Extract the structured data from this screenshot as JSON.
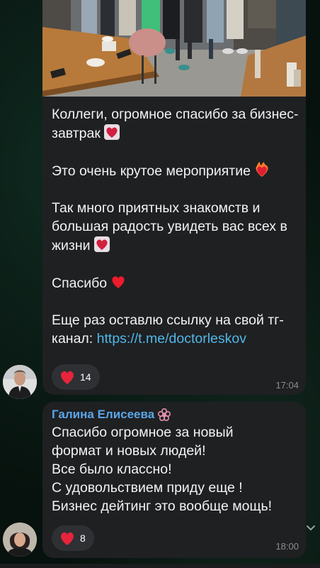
{
  "message1": {
    "paragraphs": [
      "Коллеги, огромное спасибо за бизнес-завтрак",
      "Это очень крутое мероприятие",
      "Так много приятных знакомств и большая радость увидеть вас всех в жизни",
      "Спасибо",
      "Еще раз оставлю ссылку на свой тг-канал:"
    ],
    "link": "https://t.me/doctorleskov",
    "reaction": {
      "icon": "heart-icon",
      "count": "14"
    },
    "time": "17:04"
  },
  "message2": {
    "sender": "Галина Елисеева",
    "lines": [
      "Спасибо огромное за новый",
      "формат и новых людей!",
      "Все было классно!",
      "С удовольствием приду еще !",
      "Бизнес дейтинг это вообще мощь!"
    ],
    "reaction": {
      "icon": "heart-icon",
      "count": "8"
    },
    "time": "18:00"
  },
  "colors": {
    "bubble": "#1f2022",
    "link": "#4fb7e8",
    "sender_name": "#5aa6e8",
    "heart": "#e8243c"
  }
}
